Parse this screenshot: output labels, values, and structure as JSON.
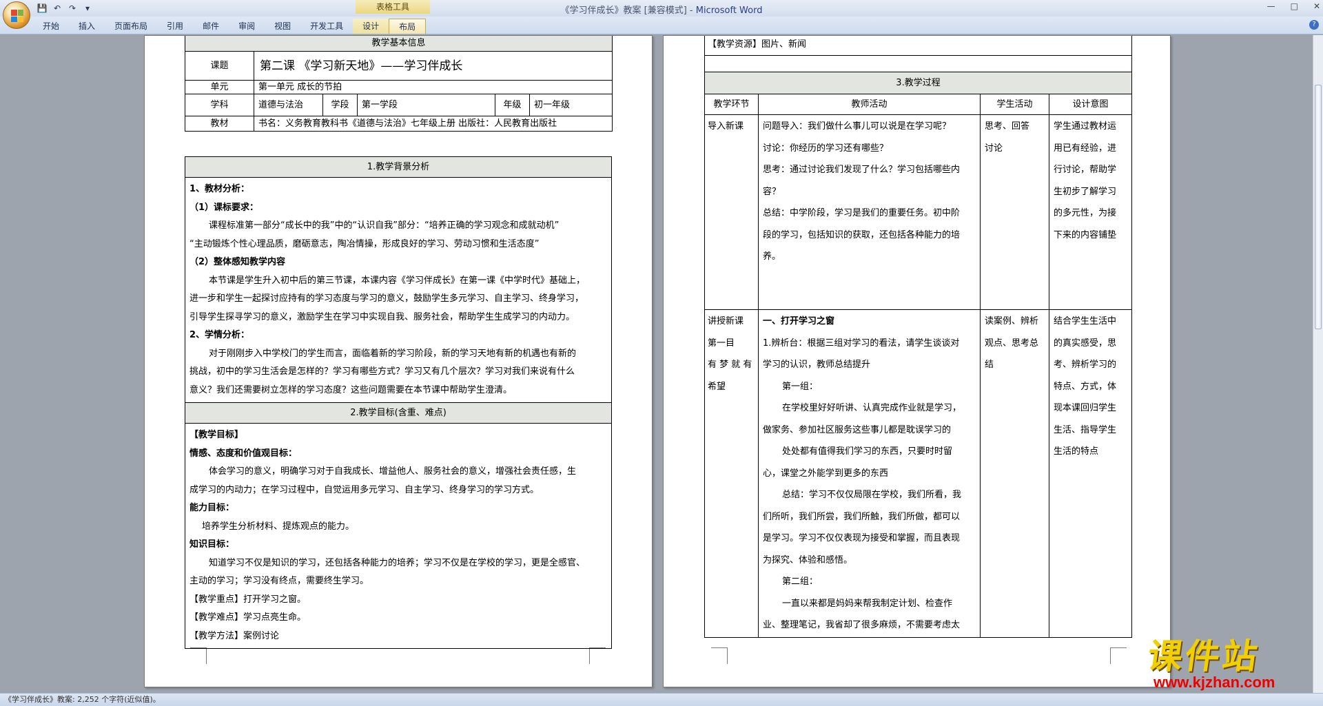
{
  "window": {
    "doc_title": "《学习伴成长》教案 [兼容模式] - ",
    "app_name": "Microsoft Word",
    "context_tab_group": "表格工具"
  },
  "ribbon": {
    "tabs": [
      "开始",
      "插入",
      "页面布局",
      "引用",
      "邮件",
      "审阅",
      "视图",
      "开发工具",
      "设计",
      "布局"
    ]
  },
  "status": {
    "text": "《学习伴成长》教案: 2,252 个字符(近似值)。"
  },
  "left_page": {
    "info_header": "教学基本信息",
    "lbl_topic": "课题",
    "topic": "第二课 《学习新天地》——学习伴成长",
    "lbl_unit": "单元",
    "unit": "第一单元 成长的节拍",
    "lbl_subject": "学科",
    "subject": "道德与法治",
    "lbl_stage": "学段",
    "stage": "第一学段",
    "lbl_grade": "年级",
    "grade": "初一年级",
    "lbl_textbook": "教材",
    "textbook": "书名：义务教育教科书《道德与法治》七年级上册    出版社：人民教育出版社",
    "bg_header": "1.教学背景分析",
    "bg_lines": [
      "1、教材分析：",
      "（1）课标要求：",
      "课程标准第一部分“成长中的我”中的“认识自我”部分：“培养正确的学习观念和成就动机”",
      "“主动锻炼个性心理品质，磨砺意志，陶冶情操，形成良好的学习、劳动习惯和生活态度”",
      "（2）整体感知教学内容",
      "本节课是学生升入初中后的第三节课，本课内容《学习伴成长》在第一课《中学时代》基础上，",
      "进一步和学生一起探讨应持有的学习态度与学习的意义，鼓励学生多元学习、自主学习、终身学习，",
      "引导学生探寻学习的意义，激励学生在学习中实现自我、服务社会，帮助学生生成学习的内动力。",
      "2、学情分析：",
      "对于刚刚步入中学校门的学生而言，面临着新的学习阶段，新的学习天地有新的机遇也有新的",
      "挑战，初中的学习生活会是怎样的？学习有哪些方式？学习又有几个层次？学习对我们来说有什么",
      "意义？我们还需要树立怎样的学习态度？这些问题需要在本节课中帮助学生澄清。"
    ],
    "goal_header": "2.教学目标(含重、难点)",
    "goal_lines": [
      "【教学目标】",
      "情感、态度和价值观目标：",
      "体会学习的意义，明确学习对于自我成长、增益他人、服务社会的意义，增强社会责任感，生",
      "成学习的内动力；在学习过程中，自觉运用多元学习、自主学习、终身学习的学习方式。",
      "能力目标：",
      "培养学生分析材料、提炼观点的能力。",
      "知识目标：",
      "知道学习不仅是知识的学习，还包括各种能力的培养；学习不仅是在学校的学习，更是全感官、",
      "主动的学习；学习没有终点，需要终生学习。",
      "【教学重点】打开学习之窗。",
      "【教学难点】学习点亮生命。",
      "【教学方法】案例讨论"
    ]
  },
  "right_page": {
    "resources": "【教学资源】图片、新闻",
    "process_header": "3.教学过程",
    "col_headers": [
      "教学环节",
      "教师活动",
      "学生活动",
      "设计意图"
    ],
    "row1": {
      "stage": [
        "导入新课"
      ],
      "teacher": [
        "问题导入：我们做什么事儿可以说是在学习呢？",
        "",
        "讨论：你经历的学习还有哪些？",
        "思考：通过讨论我们发现了什么？学习包括哪些内",
        "容？",
        "总结：中学阶段，学习是我们的重要任务。初中阶",
        "段的学习，包括知识的获取，还包括各种能力的培",
        "养。",
        ""
      ],
      "student": [
        "思考、回答",
        "",
        "讨论",
        "",
        ""
      ],
      "design": [
        "学生通过教材运",
        "用已有经验，进",
        "行讨论，帮助学",
        "生初步了解学习",
        "的多元性，为接",
        "下来的内容铺垫"
      ]
    },
    "row2": {
      "stage": [
        "讲授新课",
        "",
        "",
        "",
        "",
        "",
        "",
        "",
        "",
        "第一目",
        "有 梦 就 有",
        "希望",
        "",
        ""
      ],
      "teacher": [
        "一、打开学习之窗",
        "1.辨析台：根据三组对学习的看法，请学生谈谈对",
        "学习的认识，教师总结提升",
        "第一组：",
        "在学校里好好听讲、认真完成作业就是学习，",
        "做家务、参加社区服务这些事儿都是耽误学习的",
        "处处都有值得我们学习的东西，只要时时留",
        "心，课堂之外能学到更多的东西",
        "总结：学习不仅仅局限在学校，我们所看，我",
        "们所听，我们所尝，我们所触，我们所做，都可以",
        "是学习。学习不仅仅表现为接受和掌握，而且表现",
        "为探究、体验和感悟。",
        "第二组：",
        "一直以来都是妈妈来帮我制定计划、检查作",
        "业、整理笔记，我省却了很多麻烦，不需要考虑太"
      ],
      "student": [
        "",
        "",
        "读案例、辨析",
        "观点、思考总",
        "结",
        "",
        "",
        "",
        "",
        "",
        "",
        "",
        "",
        "",
        ""
      ],
      "design": [
        "",
        "",
        "结合学生生活中",
        "的真实感受，思",
        "考、辨析学习的",
        "特点、方式，体",
        "现本课回归学生",
        "生活、指导学生",
        "生活的特点",
        "",
        "",
        "",
        "",
        "",
        ""
      ]
    }
  },
  "watermark": {
    "title": "课件站",
    "url": "www.kjzhan.com"
  }
}
